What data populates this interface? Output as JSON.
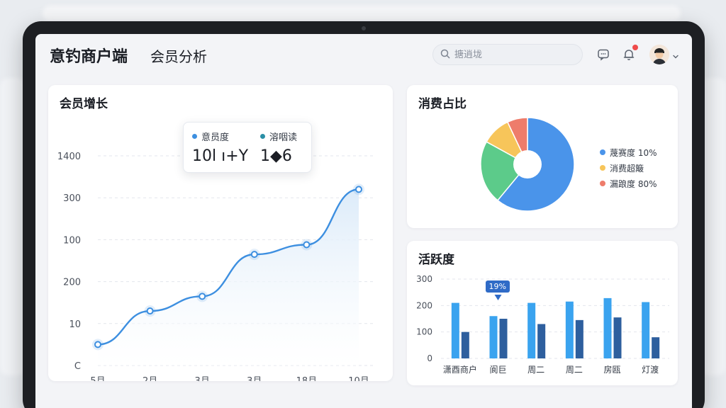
{
  "header": {
    "brand": "意钓商户端",
    "page_title": "会员分析",
    "search_placeholder": "搪逍垅"
  },
  "colors": {
    "accent": "#3d8fe0",
    "area_fill": "#dcebf9",
    "bar_light": "#3aa3ef",
    "bar_dark": "#2e5f9e",
    "pie_blue": "#4a94ea",
    "pie_green": "#5ccb8a",
    "pie_yellow": "#f7c55a",
    "pie_red": "#ee7c6b"
  },
  "growth": {
    "title": "会员增长",
    "tooltip": {
      "a_label": "意员度",
      "a_value": "10l ı+Y",
      "b_label": "溶咽读",
      "b_value": "1◆6"
    },
    "chart_data": {
      "type": "area",
      "ytick_labels": [
        "1400",
        "300",
        "100",
        "200",
        "10",
        "C"
      ],
      "xtick_labels": [
        "5月",
        "2月",
        "3月",
        "3月",
        "18月",
        "10月"
      ],
      "points": [
        0.5,
        1.3,
        1.65,
        2.65,
        2.88,
        4.2
      ],
      "ylim": [
        0,
        5
      ],
      "grid": true
    }
  },
  "share": {
    "title": "消费占比",
    "chart_data": {
      "type": "pie",
      "slices": [
        {
          "label": "蔑赛度 10%",
          "value": 61,
          "color": "#4a94ea"
        },
        {
          "label": "",
          "value": 22,
          "color": "#5ccb8a"
        },
        {
          "label": "消费超簸",
          "value": 10,
          "color": "#f7c55a"
        },
        {
          "label": "漏踉度 80%",
          "value": 7,
          "color": "#ee7c6b"
        }
      ],
      "legend": [
        "蔑赛度 10%",
        "消费超簸",
        "漏踉度 80%"
      ],
      "legend_colors": [
        "#4a94ea",
        "#f7c55a",
        "#ee7c6b"
      ]
    }
  },
  "activity": {
    "title": "活跃度",
    "chart_data": {
      "type": "bar",
      "categories": [
        "潇酉商户",
        "阆巨",
        "周二",
        "周二",
        "房瓯",
        "灯渡"
      ],
      "series": [
        {
          "values": [
            210,
            160,
            210,
            215,
            228,
            213
          ]
        },
        {
          "values": [
            100,
            150,
            130,
            145,
            155,
            80
          ]
        }
      ],
      "ytick_labels": [
        "300",
        "200",
        "100",
        "0"
      ],
      "ylim": [
        0,
        300
      ],
      "annotation": "19%"
    }
  }
}
